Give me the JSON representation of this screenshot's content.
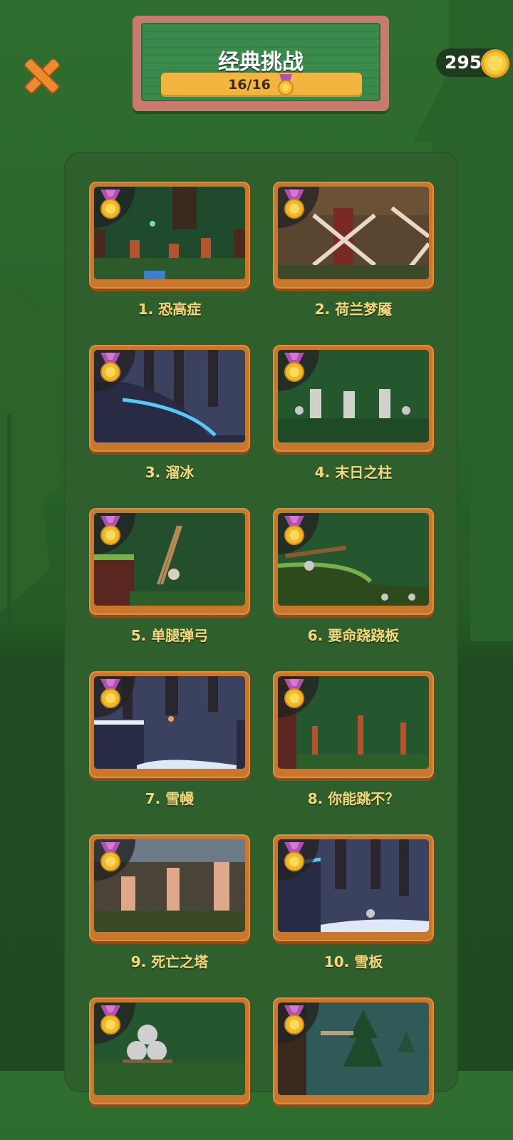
{
  "header": {
    "title": "经典挑战",
    "progress": "16/16",
    "coins": "295"
  },
  "levels": [
    {
      "label": "1. 恐高症",
      "theme": "forest-columns"
    },
    {
      "label": "2. 荷兰梦魇",
      "theme": "windmill"
    },
    {
      "label": "3. 溜冰",
      "theme": "ice-slide"
    },
    {
      "label": "4. 末日之柱",
      "theme": "pillars"
    },
    {
      "label": "5. 单腿弹弓",
      "theme": "slingshot"
    },
    {
      "label": "6. 要命跷跷板",
      "theme": "seesaw"
    },
    {
      "label": "7. 雪幔",
      "theme": "snow-cave"
    },
    {
      "label": "8. 你能跳不？",
      "theme": "forest-poles"
    },
    {
      "label": "9. 死亡之塔",
      "theme": "towers"
    },
    {
      "label": "10. 雪板",
      "theme": "snowboard"
    },
    {
      "label": "",
      "theme": "boulders"
    },
    {
      "label": "",
      "theme": "pine-forest"
    }
  ],
  "colors": {
    "accent_gold": "#f2b640",
    "label_text": "#f5d77a",
    "frame_wood": "#c8772c",
    "medal_ribbon": "#b04fb0"
  }
}
